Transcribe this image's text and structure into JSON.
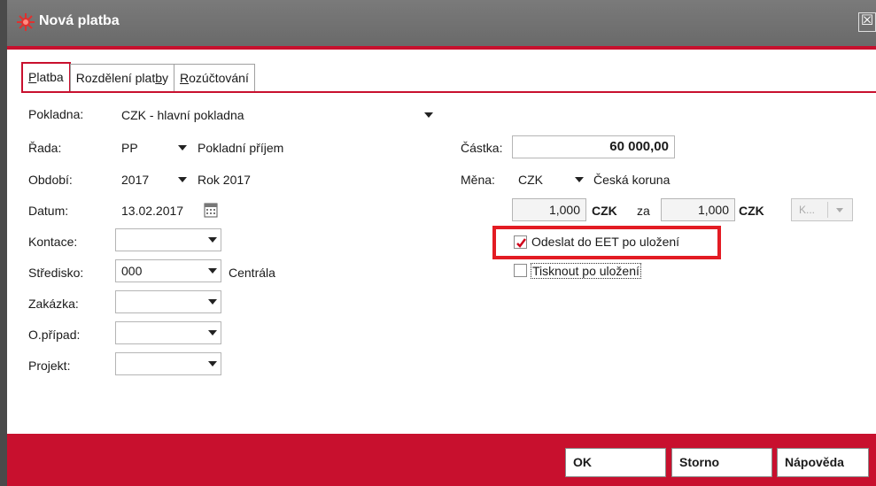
{
  "window": {
    "title": "Nová platba",
    "close_glyph": "☒",
    "icon": "eet-logo-icon",
    "accent_color": "#c8102e"
  },
  "tabs": [
    {
      "pre": "",
      "u": "P",
      "post": "latba"
    },
    {
      "pre": "Rozdělení plat",
      "u": "b",
      "post": "y"
    },
    {
      "pre": "",
      "u": "R",
      "post": "ozúčtování"
    }
  ],
  "form": {
    "pokladna": {
      "label": "Pokladna:",
      "value": "CZK - hlavní pokladna"
    },
    "rada": {
      "label": "Řada:",
      "value": "PP",
      "desc": "Pokladní příjem"
    },
    "obdobi": {
      "label": "Období:",
      "value": "2017",
      "desc": "Rok 2017"
    },
    "datum": {
      "label": "Datum:",
      "value": "13.02.2017"
    },
    "kontace": {
      "label": "Kontace:",
      "value": ""
    },
    "stredisko": {
      "label": "Středisko:",
      "value": "000",
      "desc": "Centrála"
    },
    "zakazka": {
      "label": "Zakázka:",
      "value": ""
    },
    "opripad": {
      "label": "O.případ:",
      "value": ""
    },
    "projekt": {
      "label": "Projekt:",
      "value": ""
    }
  },
  "right": {
    "castka": {
      "label": "Částka:",
      "value": "60 000,00"
    },
    "mena": {
      "label": "Měna:",
      "value": "CZK",
      "desc": "Česká koruna"
    },
    "rate": {
      "value1": "1,000",
      "cur1": "CZK",
      "za": "za",
      "value2": "1,000",
      "cur2": "CZK",
      "btn": "K..."
    },
    "eet_checkbox": {
      "label": "Odeslat do EET po uložení",
      "checked": true
    },
    "print_checkbox": {
      "label": "Tisknout po uložení",
      "checked": false
    }
  },
  "buttons": {
    "ok": "OK",
    "storno": "Storno",
    "napoveda": "Nápověda"
  }
}
